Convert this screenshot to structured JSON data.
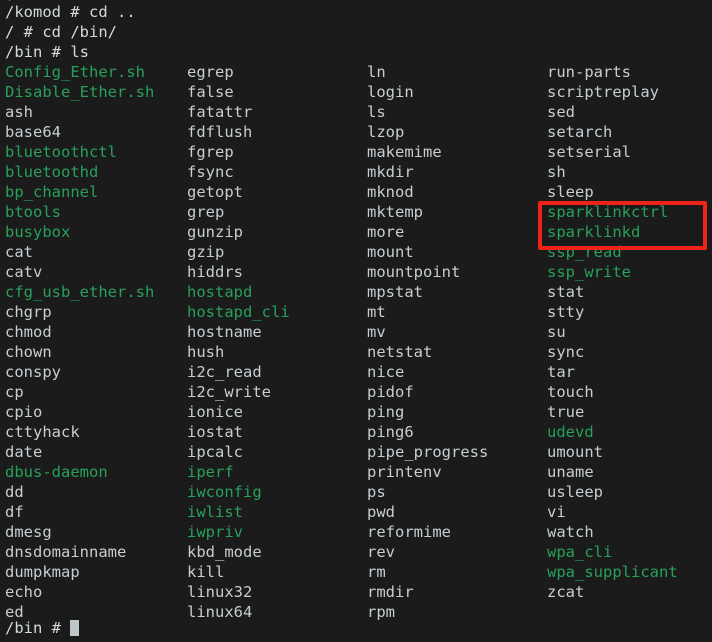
{
  "terminal": {
    "background_color": "#1b1b1b",
    "exec_color": "#28a05a",
    "file_color": "#c6ced2",
    "prompt_color": "#d3dadd",
    "highlight_color": "#ef2418",
    "scroll_remnant": "."
  },
  "prompts": {
    "cd_up": "/komod # cd ..",
    "cd_bin": "/ # cd /bin/",
    "ls": "/bin # ls",
    "final": "/bin # "
  },
  "listing": {
    "columns": [
      {
        "name": "column-1",
        "entries": [
          {
            "name": "Config_Ether.sh",
            "type": "exec"
          },
          {
            "name": "Disable_Ether.sh",
            "type": "exec"
          },
          {
            "name": "ash",
            "type": "file"
          },
          {
            "name": "base64",
            "type": "file"
          },
          {
            "name": "bluetoothctl",
            "type": "exec"
          },
          {
            "name": "bluetoothd",
            "type": "exec"
          },
          {
            "name": "bp_channel",
            "type": "exec"
          },
          {
            "name": "btools",
            "type": "exec"
          },
          {
            "name": "busybox",
            "type": "exec"
          },
          {
            "name": "cat",
            "type": "file"
          },
          {
            "name": "catv",
            "type": "file"
          },
          {
            "name": "cfg_usb_ether.sh",
            "type": "exec"
          },
          {
            "name": "chgrp",
            "type": "file"
          },
          {
            "name": "chmod",
            "type": "file"
          },
          {
            "name": "chown",
            "type": "file"
          },
          {
            "name": "conspy",
            "type": "file"
          },
          {
            "name": "cp",
            "type": "file"
          },
          {
            "name": "cpio",
            "type": "file"
          },
          {
            "name": "cttyhack",
            "type": "file"
          },
          {
            "name": "date",
            "type": "file"
          },
          {
            "name": "dbus-daemon",
            "type": "exec"
          },
          {
            "name": "dd",
            "type": "file"
          },
          {
            "name": "df",
            "type": "file"
          },
          {
            "name": "dmesg",
            "type": "file"
          },
          {
            "name": "dnsdomainname",
            "type": "file"
          },
          {
            "name": "dumpkmap",
            "type": "file"
          },
          {
            "name": "echo",
            "type": "file"
          },
          {
            "name": "ed",
            "type": "file"
          }
        ]
      },
      {
        "name": "column-2",
        "entries": [
          {
            "name": "egrep",
            "type": "file"
          },
          {
            "name": "false",
            "type": "file"
          },
          {
            "name": "fatattr",
            "type": "file"
          },
          {
            "name": "fdflush",
            "type": "file"
          },
          {
            "name": "fgrep",
            "type": "file"
          },
          {
            "name": "fsync",
            "type": "file"
          },
          {
            "name": "getopt",
            "type": "file"
          },
          {
            "name": "grep",
            "type": "file"
          },
          {
            "name": "gunzip",
            "type": "file"
          },
          {
            "name": "gzip",
            "type": "file"
          },
          {
            "name": "hiddrs",
            "type": "file"
          },
          {
            "name": "hostapd",
            "type": "exec"
          },
          {
            "name": "hostapd_cli",
            "type": "exec"
          },
          {
            "name": "hostname",
            "type": "file"
          },
          {
            "name": "hush",
            "type": "file"
          },
          {
            "name": "i2c_read",
            "type": "file"
          },
          {
            "name": "i2c_write",
            "type": "file"
          },
          {
            "name": "ionice",
            "type": "file"
          },
          {
            "name": "iostat",
            "type": "file"
          },
          {
            "name": "ipcalc",
            "type": "file"
          },
          {
            "name": "iperf",
            "type": "exec"
          },
          {
            "name": "iwconfig",
            "type": "exec"
          },
          {
            "name": "iwlist",
            "type": "exec"
          },
          {
            "name": "iwpriv",
            "type": "exec"
          },
          {
            "name": "kbd_mode",
            "type": "file"
          },
          {
            "name": "kill",
            "type": "file"
          },
          {
            "name": "linux32",
            "type": "file"
          },
          {
            "name": "linux64",
            "type": "file"
          }
        ]
      },
      {
        "name": "column-3",
        "entries": [
          {
            "name": "ln",
            "type": "file"
          },
          {
            "name": "login",
            "type": "file"
          },
          {
            "name": "ls",
            "type": "file"
          },
          {
            "name": "lzop",
            "type": "file"
          },
          {
            "name": "makemime",
            "type": "file"
          },
          {
            "name": "mkdir",
            "type": "file"
          },
          {
            "name": "mknod",
            "type": "file"
          },
          {
            "name": "mktemp",
            "type": "file"
          },
          {
            "name": "more",
            "type": "file"
          },
          {
            "name": "mount",
            "type": "file"
          },
          {
            "name": "mountpoint",
            "type": "file"
          },
          {
            "name": "mpstat",
            "type": "file"
          },
          {
            "name": "mt",
            "type": "file"
          },
          {
            "name": "mv",
            "type": "file"
          },
          {
            "name": "netstat",
            "type": "file"
          },
          {
            "name": "nice",
            "type": "file"
          },
          {
            "name": "pidof",
            "type": "file"
          },
          {
            "name": "ping",
            "type": "file"
          },
          {
            "name": "ping6",
            "type": "file"
          },
          {
            "name": "pipe_progress",
            "type": "file"
          },
          {
            "name": "printenv",
            "type": "file"
          },
          {
            "name": "ps",
            "type": "file"
          },
          {
            "name": "pwd",
            "type": "file"
          },
          {
            "name": "reformime",
            "type": "file"
          },
          {
            "name": "rev",
            "type": "file"
          },
          {
            "name": "rm",
            "type": "file"
          },
          {
            "name": "rmdir",
            "type": "file"
          },
          {
            "name": "rpm",
            "type": "file"
          }
        ]
      },
      {
        "name": "column-4",
        "entries": [
          {
            "name": "run-parts",
            "type": "file"
          },
          {
            "name": "scriptreplay",
            "type": "file"
          },
          {
            "name": "sed",
            "type": "file"
          },
          {
            "name": "setarch",
            "type": "file"
          },
          {
            "name": "setserial",
            "type": "file"
          },
          {
            "name": "sh",
            "type": "file"
          },
          {
            "name": "sleep",
            "type": "file"
          },
          {
            "name": "sparklinkctrl",
            "type": "exec"
          },
          {
            "name": "sparklinkd",
            "type": "exec"
          },
          {
            "name": "ssp_read",
            "type": "exec"
          },
          {
            "name": "ssp_write",
            "type": "exec"
          },
          {
            "name": "stat",
            "type": "file"
          },
          {
            "name": "stty",
            "type": "file"
          },
          {
            "name": "su",
            "type": "file"
          },
          {
            "name": "sync",
            "type": "file"
          },
          {
            "name": "tar",
            "type": "file"
          },
          {
            "name": "touch",
            "type": "file"
          },
          {
            "name": "true",
            "type": "file"
          },
          {
            "name": "udevd",
            "type": "exec"
          },
          {
            "name": "umount",
            "type": "file"
          },
          {
            "name": "uname",
            "type": "file"
          },
          {
            "name": "usleep",
            "type": "file"
          },
          {
            "name": "vi",
            "type": "file"
          },
          {
            "name": "watch",
            "type": "file"
          },
          {
            "name": "wpa_cli",
            "type": "exec"
          },
          {
            "name": "wpa_supplicant",
            "type": "exec"
          },
          {
            "name": "zcat",
            "type": "file"
          }
        ]
      }
    ]
  },
  "highlight": {
    "label": "sparklink-binaries-highlight",
    "entries": [
      "sparklinkctrl",
      "sparklinkd"
    ]
  }
}
